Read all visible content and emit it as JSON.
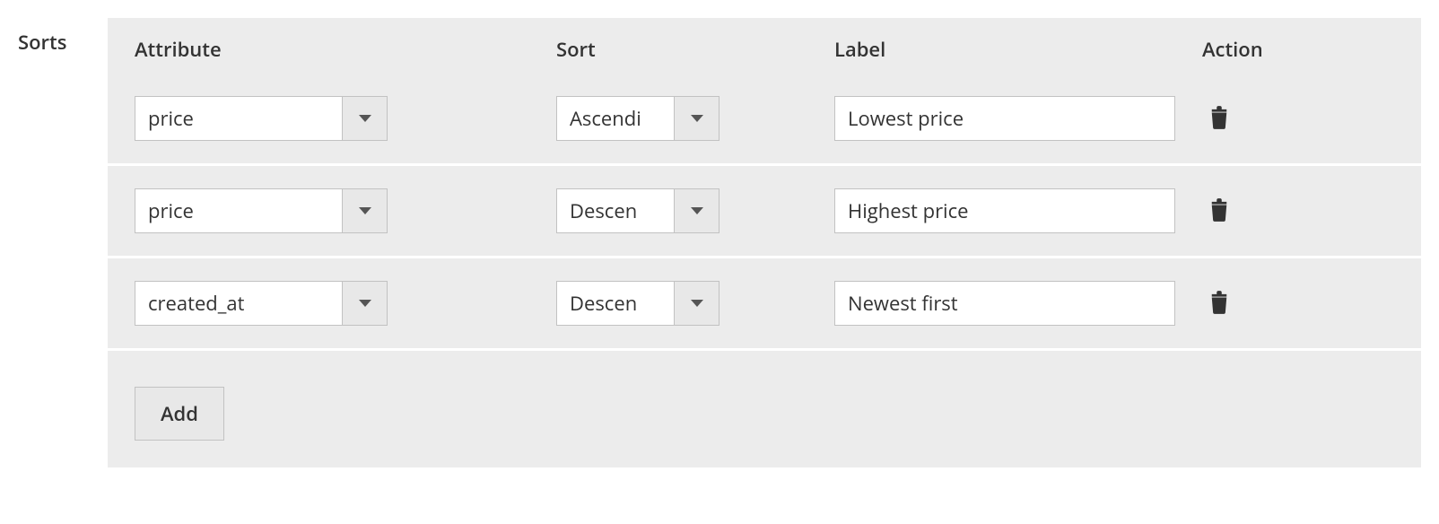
{
  "section_label": "Sorts",
  "headers": {
    "attribute": "Attribute",
    "sort": "Sort",
    "label": "Label",
    "action": "Action"
  },
  "rows": [
    {
      "attribute": "price",
      "sort": "Ascendi",
      "label": "Lowest price"
    },
    {
      "attribute": "price",
      "sort": "Descen",
      "label": "Highest price"
    },
    {
      "attribute": "created_at",
      "sort": "Descen",
      "label": "Newest first"
    }
  ],
  "add_button": "Add"
}
